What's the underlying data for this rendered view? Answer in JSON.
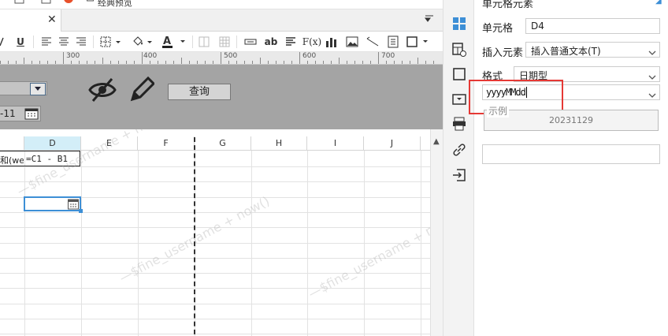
{
  "top_strip": {
    "items": [
      "经典预览"
    ]
  },
  "toolbar": {
    "underline_label": "U",
    "ab_label": "ab",
    "fx_label": "F(x)"
  },
  "ruler": {
    "labels": [
      "300",
      "400",
      "500",
      "600",
      "700"
    ]
  },
  "param_panel": {
    "date_value": "-11",
    "query_button": "查询"
  },
  "grid": {
    "columns": [
      "D",
      "E",
      "F",
      "G",
      "H",
      "I",
      "J"
    ],
    "selected_column": "D",
    "cells": {
      "c_row1": "和(we",
      "d_row1": "=C1 - B1"
    },
    "watermark": "—$fine_username + now()"
  },
  "properties": {
    "title": "单元格元素",
    "cell_label": "单元格",
    "cell_value": "D4",
    "insert_label": "插入元素",
    "insert_value": "插入普通文本(T)",
    "format_label": "格式",
    "format_value": "日期型",
    "pattern_value": "yyyyMMdd",
    "example_legend": "示例",
    "example_value": "20231129"
  },
  "colors": {
    "accent": "#3d8fd6",
    "highlight_box": "#e53935",
    "param_bg": "#a4a4a4",
    "selected_header": "#d3eef8"
  }
}
